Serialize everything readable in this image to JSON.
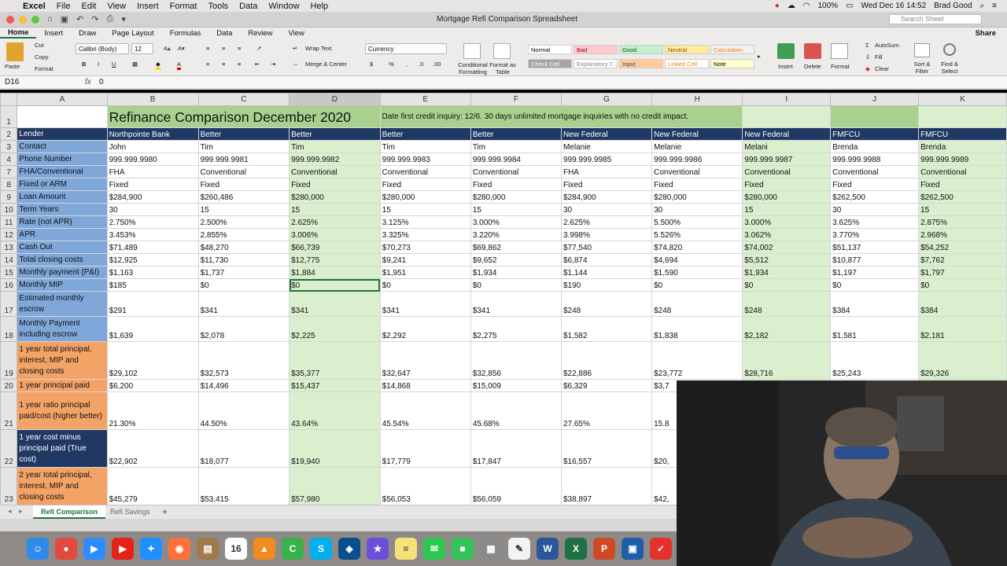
{
  "menubar": {
    "app": "Excel",
    "items": [
      "File",
      "Edit",
      "View",
      "Insert",
      "Format",
      "Tools",
      "Data",
      "Window",
      "Help"
    ],
    "battery": "100%",
    "datetime": "Wed Dec 16  14:52",
    "user": "Brad Good"
  },
  "window": {
    "title": "Mortgage Refi Comparison Spreadsheet",
    "search_placeholder": "Search Sheet"
  },
  "ribbon_tabs": [
    "Home",
    "Insert",
    "Draw",
    "Page Layout",
    "Formulas",
    "Data",
    "Review",
    "View"
  ],
  "active_tab": "Home",
  "share_label": "Share",
  "ribbon": {
    "paste": "Paste",
    "cut": "Cut",
    "copy": "Copy",
    "format": "Format",
    "font_name": "Calibri (Body)",
    "font_size": "12",
    "wrap_text": "Wrap Text",
    "merge_center": "Merge & Center",
    "number_format": "Currency",
    "conditional_formatting": "Conditional Formatting",
    "format_as_table": "Format as Table",
    "styles": [
      {
        "label": "Normal",
        "bg": "#ffffff",
        "fg": "#000000"
      },
      {
        "label": "Bad",
        "bg": "#ffc7ce",
        "fg": "#9c0006"
      },
      {
        "label": "Good",
        "bg": "#c6efce",
        "fg": "#006100"
      },
      {
        "label": "Neutral",
        "bg": "#ffeb9c",
        "fg": "#9c5700"
      },
      {
        "label": "Calculation",
        "bg": "#f2f2f2",
        "fg": "#fa7d00"
      },
      {
        "label": "Check Cell",
        "bg": "#a5a5a5",
        "fg": "#ffffff"
      },
      {
        "label": "Explanatory T...",
        "bg": "#ffffff",
        "fg": "#7f7f7f"
      },
      {
        "label": "Input",
        "bg": "#ffcc99",
        "fg": "#3f3f76"
      },
      {
        "label": "Linked Cell",
        "bg": "#ffffff",
        "fg": "#fa7d00"
      },
      {
        "label": "Note",
        "bg": "#ffffcc",
        "fg": "#000000"
      }
    ],
    "insert": "Insert",
    "delete": "Delete",
    "format_cells": "Format",
    "autosum": "AutoSum",
    "fill": "Fill",
    "clear": "Clear",
    "sort_filter": "Sort & Filter",
    "find_select": "Find & Select"
  },
  "formula_bar": {
    "name_box": "D16",
    "fx": "fx",
    "value": "0"
  },
  "columns": [
    "A",
    "B",
    "C",
    "D",
    "E",
    "F",
    "G",
    "H",
    "I",
    "J",
    "K"
  ],
  "selected_column": "D",
  "sheet": {
    "title": "Refinance Comparison December 2020",
    "note": "Date first credit inquiry:  12/6.  30 days unlimited mortgage inquiries with no credit impact.",
    "rows": [
      {
        "num": "2",
        "label": "Lender",
        "cells": [
          "Northpointe Bank",
          "Better",
          "Better",
          "Better",
          "Better",
          "New Federal",
          "New Federal",
          "New Federal",
          "FMFCU",
          "FMFCU"
        ]
      },
      {
        "num": "3",
        "label": "Contact",
        "cells": [
          "John",
          "Tim",
          "Tim",
          "Tim",
          "Tim",
          "Melanie",
          "Melanie",
          "Melani",
          "Brenda",
          "Brenda"
        ]
      },
      {
        "num": "4",
        "label": "Phone Number",
        "cells": [
          "999.999.9980",
          "999.999.9981",
          "999.999.9982",
          "999.999.9983",
          "999.999.9984",
          "999.999.9985",
          "999.999.9986",
          "999.999.9987",
          "999.999.9988",
          "999.999.9989"
        ]
      },
      {
        "num": "7",
        "label": "FHA/Conventional",
        "cells": [
          "FHA",
          "Conventional",
          "Conventional",
          "Conventional",
          "Conventional",
          "FHA",
          "Conventional",
          "Conventional",
          "Conventional",
          "Conventional"
        ]
      },
      {
        "num": "8",
        "label": "Fixed or ARM",
        "cells": [
          "Fixed",
          "Fixed",
          "Fixed",
          "Fixed",
          "Fixed",
          "Fixed",
          "Fixed",
          "Fixed",
          "Fixed",
          "Fixed"
        ]
      },
      {
        "num": "9",
        "label": "Loan Amount",
        "cells": [
          "$284,900",
          "$260,486",
          "$280,000",
          "$280,000",
          "$280,000",
          "$284,900",
          "$280,000",
          "$280,000",
          "$262,500",
          "$262,500"
        ]
      },
      {
        "num": "10",
        "label": "Term Years",
        "cells": [
          "30",
          "15",
          "15",
          "15",
          "15",
          "30",
          "30",
          "15",
          "30",
          "15"
        ]
      },
      {
        "num": "11",
        "label": "Rate (not APR)",
        "cells": [
          "2.750%",
          "2.500%",
          "2.625%",
          "3.125%",
          "3.000%",
          "2.625%",
          "5.500%",
          "3.000%",
          "3.625%",
          "2.875%"
        ]
      },
      {
        "num": "12",
        "label": "APR",
        "cells": [
          "3.453%",
          "2.855%",
          "3.006%",
          "3.325%",
          "3.220%",
          "3.998%",
          "5.526%",
          "3.062%",
          "3.770%",
          "2.968%"
        ]
      },
      {
        "num": "13",
        "label": "Cash Out",
        "cells": [
          "$71,489",
          "$48,270",
          "$66,739",
          "$70,273",
          "$69,862",
          "$77,540",
          "$74,820",
          "$74,002",
          "$51,137",
          "$54,252"
        ]
      },
      {
        "num": "14",
        "label": "Total closing costs",
        "cells": [
          "$12,925",
          "$11,730",
          "$12,775",
          "$9,241",
          "$9,652",
          "$6,874",
          "$4,694",
          "$5,512",
          "$10,877",
          "$7,762"
        ]
      },
      {
        "num": "15",
        "label": "Monthly payment (P&I)",
        "cells": [
          "$1,163",
          "$1,737",
          "$1,884",
          "$1,951",
          "$1,934",
          "$1,144",
          "$1,590",
          "$1,934",
          "$1,197",
          "$1,797"
        ]
      },
      {
        "num": "16",
        "label": "Monthly MIP",
        "cells": [
          "$185",
          "$0",
          "$0",
          "$0",
          "$0",
          "$190",
          "$0",
          "$0",
          "$0",
          "$0"
        ]
      },
      {
        "num": "17",
        "label": "Estimated monthly escrow",
        "cells": [
          "$291",
          "$341",
          "$341",
          "$341",
          "$341",
          "$248",
          "$248",
          "$248",
          "$384",
          "$384"
        ]
      },
      {
        "num": "18",
        "label": "Monthly Payment including escrow",
        "cells": [
          "$1,639",
          "$2,078",
          "$2,225",
          "$2,292",
          "$2,275",
          "$1,582",
          "$1,838",
          "$2,182",
          "$1,581",
          "$2,181"
        ]
      },
      {
        "num": "19",
        "label": "1 year total principal, interest, MIP and closing costs",
        "cells": [
          "$29,102",
          "$32,573",
          "$35,377",
          "$32,647",
          "$32,856",
          "$22,886",
          "$23,772",
          "$28,716",
          "$25,243",
          "$29,326"
        ]
      },
      {
        "num": "20",
        "label": "1 year principal paid",
        "cells": [
          "$6,200",
          "$14,496",
          "$15,437",
          "$14,868",
          "$15,009",
          "$6,329",
          "$3,7",
          "",
          "",
          ""
        ]
      },
      {
        "num": "21",
        "label": "1 year ratio principal paid/cost (higher better)",
        "cells": [
          "21.30%",
          "44.50%",
          "43.64%",
          "45.54%",
          "45.68%",
          "27.65%",
          "15.8",
          "",
          "",
          ""
        ]
      },
      {
        "num": "22",
        "label": "1 year cost minus principal paid (True cost)",
        "cells": [
          "$22,902",
          "$18,077",
          "$19,940",
          "$17,779",
          "$17,847",
          "$16,557",
          "$20,",
          "",
          "",
          ""
        ]
      },
      {
        "num": "23",
        "label": "2 year total principal, interest, MIP and closing costs",
        "cells": [
          "$45,279",
          "$53,415",
          "$57,980",
          "$56,053",
          "$56,059",
          "$38,897",
          "$42,",
          "",
          "",
          ""
        ]
      }
    ]
  },
  "sheet_tabs": [
    "Refi Comparison",
    "Refi Savings"
  ],
  "active_sheet": "Refi Comparison",
  "dock": [
    {
      "name": "finder-icon",
      "color": "#2f8bea",
      "glyph": "☺"
    },
    {
      "name": "chrome-icon",
      "color": "#e24a3b",
      "glyph": "●"
    },
    {
      "name": "zoom-icon",
      "color": "#2d8cff",
      "glyph": "▶"
    },
    {
      "name": "youtube-icon",
      "color": "#e62117",
      "glyph": "▶"
    },
    {
      "name": "safari-icon",
      "color": "#1e90ff",
      "glyph": "✦"
    },
    {
      "name": "firefox-icon",
      "color": "#ff7139",
      "glyph": "◉"
    },
    {
      "name": "archive-icon",
      "color": "#a07a4a",
      "glyph": "▤"
    },
    {
      "name": "calendar-icon",
      "color": "#ffffff",
      "glyph": "16"
    },
    {
      "name": "vlc-icon",
      "color": "#f28c1f",
      "glyph": "▲"
    },
    {
      "name": "camtasia-icon",
      "color": "#38b24a",
      "glyph": "C"
    },
    {
      "name": "skype-icon",
      "color": "#00aff0",
      "glyph": "S"
    },
    {
      "name": "vpn-icon",
      "color": "#0a4f8c",
      "glyph": "◈"
    },
    {
      "name": "imovie-icon",
      "color": "#6b4fd8",
      "glyph": "★"
    },
    {
      "name": "notes-icon",
      "color": "#f7e27a",
      "glyph": "≡"
    },
    {
      "name": "messages-icon",
      "color": "#2bc94f",
      "glyph": "✉"
    },
    {
      "name": "facetime-icon",
      "color": "#33c45a",
      "glyph": "■"
    },
    {
      "name": "calculator-icon",
      "color": "#8a8a8a",
      "glyph": "▦"
    },
    {
      "name": "textedit-icon",
      "color": "#f3f3f3",
      "glyph": "✎"
    },
    {
      "name": "word-icon",
      "color": "#2b579a",
      "glyph": "W"
    },
    {
      "name": "excel-icon",
      "color": "#1f7244",
      "glyph": "X"
    },
    {
      "name": "powerpoint-icon",
      "color": "#d24726",
      "glyph": "P"
    },
    {
      "name": "xcode-icon",
      "color": "#1d5fa8",
      "glyph": "▣"
    },
    {
      "name": "tasks-icon",
      "color": "#e4312b",
      "glyph": "✓"
    }
  ]
}
